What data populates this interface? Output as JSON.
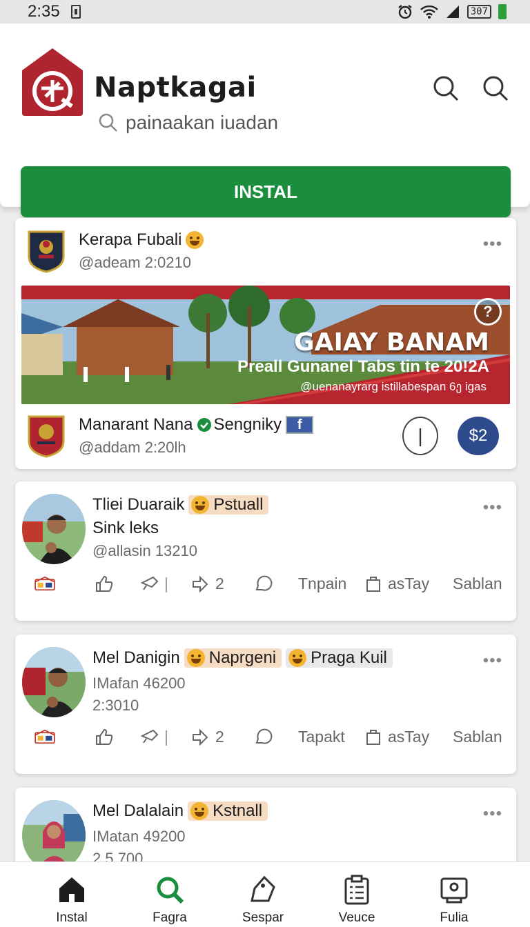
{
  "status_bar": {
    "time": "2:35",
    "battery_text": "307"
  },
  "app": {
    "name": "Naptkagai",
    "subtitle": "painaakan iuadan",
    "install_label": "INSTAL",
    "brand_color": "#1b8e3e",
    "logo_color": "#b0242f"
  },
  "feature_post": {
    "author": "Kerapa Fubali",
    "handle": "@adeam 2:0210",
    "banner": {
      "title": "GAIAY BANAM",
      "subtitle": "Preall Gunanel Tabs tin te 20!2A",
      "caption": "@uenanayrarg istillabespan 6ე igas",
      "help": "?"
    },
    "page_name": "Manarant Nana",
    "page_suffix": "Sengniky",
    "page_handle": "@addam 2:20lh",
    "action_right": "$2",
    "action_outline": "|"
  },
  "posts": [
    {
      "name": "Tliei Duaraik",
      "tag1": "Pstuall",
      "line2": "Sink leks",
      "handle": "@allasin 13210",
      "actions": {
        "share_count": "2",
        "label1": "Tnpain",
        "label2": "asTay",
        "label3": "Sablan"
      }
    },
    {
      "name": "Mel Danigin",
      "tag1": "Naprgeni",
      "tag2": "Praga Kuil",
      "line2": "IMafan 46200",
      "handle": "2:3010",
      "actions": {
        "share_count": "2",
        "label1": "Tapakt",
        "label2": "asTay",
        "label3": "Sablan"
      }
    },
    {
      "name": "Mel Dalalain",
      "tag1": "Kstnall",
      "line2": "IMatan 49200",
      "handle": "2.5 700"
    }
  ],
  "bottom_nav": [
    {
      "label": "Instal",
      "icon": "home-icon"
    },
    {
      "label": "Fagra",
      "icon": "search-icon"
    },
    {
      "label": "Sespar",
      "icon": "tag-icon"
    },
    {
      "label": "Veuce",
      "icon": "clipboard-icon"
    },
    {
      "label": "Fulia",
      "icon": "profile-card-icon"
    }
  ]
}
